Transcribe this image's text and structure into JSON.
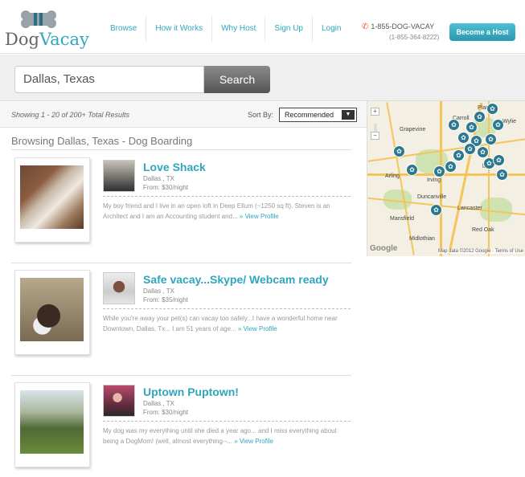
{
  "brand": {
    "dog": "Dog",
    "vacay": "Vacay"
  },
  "nav": [
    "Browse",
    "How it Works",
    "Why Host",
    "Sign Up",
    "Login"
  ],
  "phone": {
    "primary": "1-855-DOG-VACAY",
    "secondary": "(1-855-364-8222)"
  },
  "become_host": "Become a Host",
  "search": {
    "value": "Dallas, Texas",
    "button": "Search"
  },
  "results": {
    "showing": "Showing 1 - 20 of 200+ Total Results",
    "sort_label": "Sort By:",
    "sort_value": "Recommended"
  },
  "browsing": "Browsing Dallas, Texas - Dog Boarding",
  "map": {
    "cities": [
      "Grapevine",
      "Carroll",
      "Wylie",
      "Irving",
      "Arling",
      "Duncanville",
      "Lancaster",
      "Mansfield",
      "Red Oak",
      "Midlothian",
      "Plan",
      "las"
    ],
    "google": "Google",
    "credit": "Map data ©2012 Google · Terms of Use",
    "zoom_in": "+",
    "zoom_out": "−"
  },
  "listings": [
    {
      "title": "Love Shack",
      "location": "Dallas , TX",
      "price": "From: $30/night",
      "description": "My boy friend and I live in an open loft in Deep Ellum (~1250 sq ft). Steven is an Architect and I am an Accounting student and...",
      "more": "» View Profile"
    },
    {
      "title": "Safe vacay...Skype/ Webcam ready",
      "location": "Dallas , TX",
      "price": "From: $35/night",
      "description": "While you're away your pet(s) can vacay too safely...I have a wonderful home near Downtown, Dallas, Tx... I am 51 years of age...",
      "more": "» View Profile"
    },
    {
      "title": "Uptown Puptown!",
      "location": "Dallas , TX",
      "price": "From: $30/night",
      "description": "My dog was my everything until she died a year ago... and I miss everything about being a DogMom! (well, almost everything--...",
      "more": "» View Profile"
    }
  ],
  "colors": {
    "accent": "#2fa6bd",
    "pin": "#2d7891"
  }
}
